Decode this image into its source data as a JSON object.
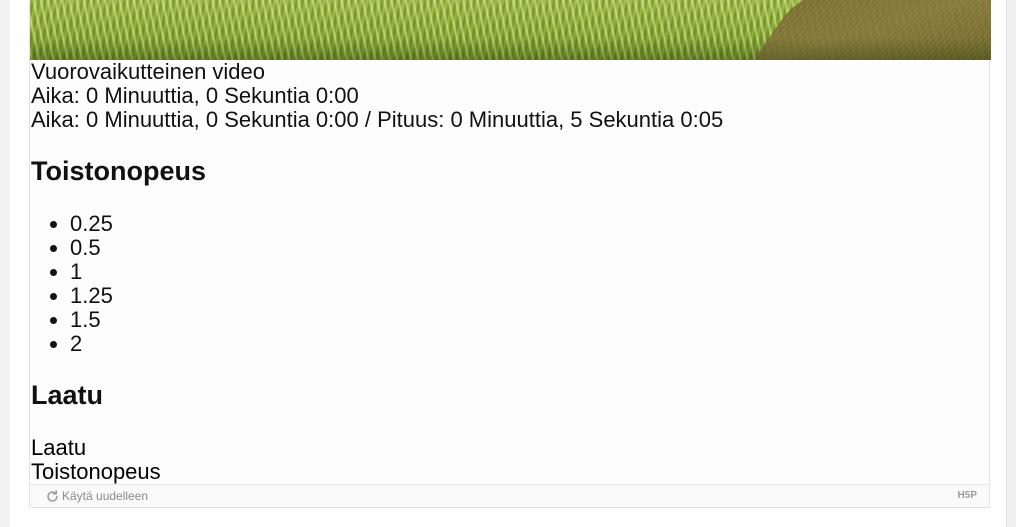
{
  "video": {
    "title": "Vuorovaikutteinen video",
    "current_time_line": "Aika: 0 Minuuttia, 0 Sekuntia 0:00",
    "time_duration_line": "Aika: 0 Minuuttia, 0 Sekuntia 0:00 / Pituus: 0 Minuuttia, 5 Sekuntia 0:05"
  },
  "playback_speed": {
    "heading": "Toistonopeus",
    "options": [
      "0.25",
      "0.5",
      "1",
      "1.25",
      "1.5",
      "2"
    ]
  },
  "quality": {
    "heading": "Laatu"
  },
  "menu_labels": {
    "quality": "Laatu",
    "playback_speed": "Toistonopeus"
  },
  "footer": {
    "retry_label": "Käytä uudelleen",
    "logo_text": "H5P",
    "retry_icon": "refresh-icon"
  },
  "colors": {
    "background": "#f2f2f2",
    "text": "#111111",
    "footer_text": "#8a8a8a"
  }
}
